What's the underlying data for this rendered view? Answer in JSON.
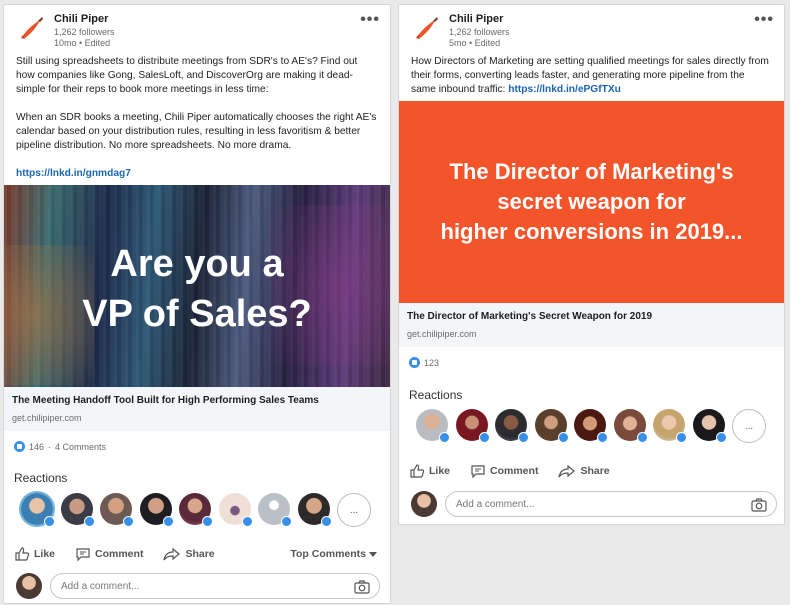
{
  "posts": [
    {
      "author": "Chili Piper",
      "followers": "1,262 followers",
      "time": "10mo • Edited",
      "menu": "•••",
      "para1": "Still using spreadsheets to distribute meetings from SDR's to AE's? Find out how companies like Gong, SalesLoft, and DiscoverOrg are making it dead-simple for their reps to book more meetings in less time:",
      "para2": "When an SDR books a meeting, Chili Piper automatically chooses the right AE's calendar based on your distribution rules, resulting in less favoritism & better pipeline distribution. No more spreadsheets. No more drama.",
      "link": "https://lnkd.in/gnmdag7",
      "hero_line1": "Are you a",
      "hero_line2": "VP of Sales?",
      "link_title": "The Meeting Handoff Tool Built for High Performing Sales Teams",
      "link_domain": "get.chilipiper.com",
      "likes": "146",
      "comments": "4 Comments",
      "reactions_label": "Reactions",
      "more": "...",
      "like": "Like",
      "comment": "Comment",
      "share": "Share",
      "top_comments": "Top Comments",
      "comment_placeholder": "Add a comment..."
    },
    {
      "author": "Chili Piper",
      "followers": "1,262 followers",
      "time": "5mo • Edited",
      "menu": "•••",
      "para1": "How Directors of Marketing are setting qualified meetings for sales directly from their forms, converting leads faster, and generating more pipeline from the same inbound traffic:",
      "link": "https://lnkd.in/ePGfTXu",
      "hero_line1": "The Director of Marketing's",
      "hero_line2": "secret weapon for",
      "hero_line3": "higher conversions in 2019...",
      "link_title": "The Director of Marketing's Secret Weapon for 2019",
      "link_domain": "get.chilipiper.com",
      "likes": "123",
      "reactions_label": "Reactions",
      "more": "...",
      "like": "Like",
      "comment": "Comment",
      "share": "Share",
      "comment_placeholder": "Add a comment..."
    }
  ],
  "colors": {
    "link": "#1a66b3",
    "like_blue": "#378fe9",
    "hero_orange": "#f4542a",
    "link_box_bg": "#f3f6f8"
  }
}
